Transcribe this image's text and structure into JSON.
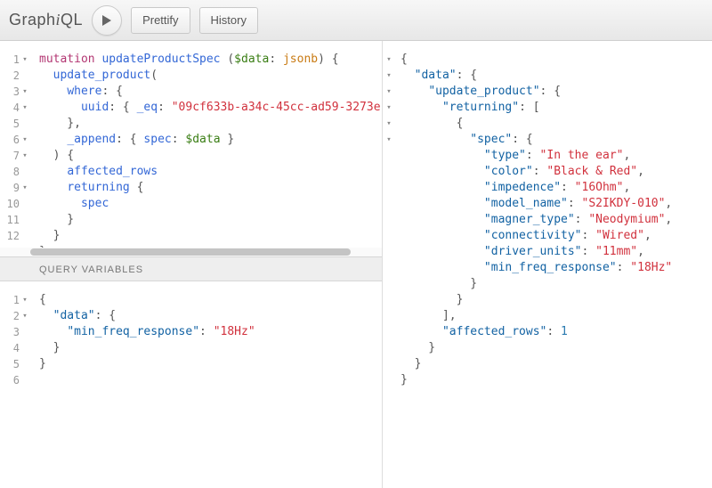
{
  "topbar": {
    "logo_pre": "Graph",
    "logo_i": "i",
    "logo_post": "QL",
    "prettify": "Prettify",
    "history": "History"
  },
  "variables_header": "QUERY VARIABLES",
  "query": {
    "lines": [
      [
        {
          "t": "mutation ",
          "c": "kw"
        },
        {
          "t": "updateProductSpec ",
          "c": "def"
        },
        {
          "t": "(",
          "c": "punc"
        },
        {
          "t": "$data",
          "c": "var"
        },
        {
          "t": ": ",
          "c": "punc"
        },
        {
          "t": "jsonb",
          "c": "type"
        },
        {
          "t": ") {",
          "c": "punc"
        }
      ],
      [
        {
          "t": "  ",
          "c": ""
        },
        {
          "t": "update_product",
          "c": "attr"
        },
        {
          "t": "(",
          "c": "punc"
        }
      ],
      [
        {
          "t": "    ",
          "c": ""
        },
        {
          "t": "where",
          "c": "attr"
        },
        {
          "t": ": {",
          "c": "punc"
        }
      ],
      [
        {
          "t": "      ",
          "c": ""
        },
        {
          "t": "uuid",
          "c": "attr"
        },
        {
          "t": ": { ",
          "c": "punc"
        },
        {
          "t": "_eq",
          "c": "attr"
        },
        {
          "t": ": ",
          "c": "punc"
        },
        {
          "t": "\"09cf633b-a34c-45cc-ad59-3273e",
          "c": "str"
        }
      ],
      [
        {
          "t": "    },",
          "c": "punc"
        }
      ],
      [
        {
          "t": "    ",
          "c": ""
        },
        {
          "t": "_append",
          "c": "attr"
        },
        {
          "t": ": { ",
          "c": "punc"
        },
        {
          "t": "spec",
          "c": "attr"
        },
        {
          "t": ": ",
          "c": "punc"
        },
        {
          "t": "$data",
          "c": "var"
        },
        {
          "t": " }",
          "c": "punc"
        }
      ],
      [
        {
          "t": "  ) {",
          "c": "punc"
        }
      ],
      [
        {
          "t": "    ",
          "c": ""
        },
        {
          "t": "affected_rows",
          "c": "attr"
        }
      ],
      [
        {
          "t": "    ",
          "c": ""
        },
        {
          "t": "returning",
          "c": "attr"
        },
        {
          "t": " {",
          "c": "punc"
        }
      ],
      [
        {
          "t": "      ",
          "c": ""
        },
        {
          "t": "spec",
          "c": "attr"
        }
      ],
      [
        {
          "t": "    }",
          "c": "punc"
        }
      ],
      [
        {
          "t": "  }",
          "c": "punc"
        }
      ],
      [
        {
          "t": "}",
          "c": "punc"
        }
      ]
    ],
    "folds": [
      1,
      0,
      1,
      1,
      0,
      1,
      1,
      0,
      1,
      0,
      0,
      0,
      0
    ]
  },
  "variables": {
    "lines": [
      [
        {
          "t": "{",
          "c": "punc"
        }
      ],
      [
        {
          "t": "  ",
          "c": ""
        },
        {
          "t": "\"data\"",
          "c": "prop"
        },
        {
          "t": ": {",
          "c": "punc"
        }
      ],
      [
        {
          "t": "    ",
          "c": ""
        },
        {
          "t": "\"min_freq_response\"",
          "c": "prop"
        },
        {
          "t": ": ",
          "c": "punc"
        },
        {
          "t": "\"18Hz\"",
          "c": "str"
        }
      ],
      [
        {
          "t": "  }",
          "c": "punc"
        }
      ],
      [
        {
          "t": "}",
          "c": "punc"
        }
      ],
      [
        {
          "t": "",
          "c": ""
        }
      ]
    ],
    "folds": [
      1,
      1,
      0,
      0,
      0,
      0
    ]
  },
  "result": {
    "lines": [
      [
        {
          "t": "{",
          "c": "punc"
        }
      ],
      [
        {
          "t": "  ",
          "c": ""
        },
        {
          "t": "\"data\"",
          "c": "prop"
        },
        {
          "t": ": {",
          "c": "punc"
        }
      ],
      [
        {
          "t": "    ",
          "c": ""
        },
        {
          "t": "\"update_product\"",
          "c": "prop"
        },
        {
          "t": ": {",
          "c": "punc"
        }
      ],
      [
        {
          "t": "      ",
          "c": ""
        },
        {
          "t": "\"returning\"",
          "c": "prop"
        },
        {
          "t": ": [",
          "c": "punc"
        }
      ],
      [
        {
          "t": "        {",
          "c": "punc"
        }
      ],
      [
        {
          "t": "          ",
          "c": ""
        },
        {
          "t": "\"spec\"",
          "c": "prop"
        },
        {
          "t": ": {",
          "c": "punc"
        }
      ],
      [
        {
          "t": "            ",
          "c": ""
        },
        {
          "t": "\"type\"",
          "c": "prop"
        },
        {
          "t": ": ",
          "c": "punc"
        },
        {
          "t": "\"In the ear\"",
          "c": "str"
        },
        {
          "t": ",",
          "c": "punc"
        }
      ],
      [
        {
          "t": "            ",
          "c": ""
        },
        {
          "t": "\"color\"",
          "c": "prop"
        },
        {
          "t": ": ",
          "c": "punc"
        },
        {
          "t": "\"Black & Red\"",
          "c": "str"
        },
        {
          "t": ",",
          "c": "punc"
        }
      ],
      [
        {
          "t": "            ",
          "c": ""
        },
        {
          "t": "\"impedence\"",
          "c": "prop"
        },
        {
          "t": ": ",
          "c": "punc"
        },
        {
          "t": "\"16Ohm\"",
          "c": "str"
        },
        {
          "t": ",",
          "c": "punc"
        }
      ],
      [
        {
          "t": "            ",
          "c": ""
        },
        {
          "t": "\"model_name\"",
          "c": "prop"
        },
        {
          "t": ": ",
          "c": "punc"
        },
        {
          "t": "\"S2IKDY-010\"",
          "c": "str"
        },
        {
          "t": ",",
          "c": "punc"
        }
      ],
      [
        {
          "t": "            ",
          "c": ""
        },
        {
          "t": "\"magner_type\"",
          "c": "prop"
        },
        {
          "t": ": ",
          "c": "punc"
        },
        {
          "t": "\"Neodymium\"",
          "c": "str"
        },
        {
          "t": ",",
          "c": "punc"
        }
      ],
      [
        {
          "t": "            ",
          "c": ""
        },
        {
          "t": "\"connectivity\"",
          "c": "prop"
        },
        {
          "t": ": ",
          "c": "punc"
        },
        {
          "t": "\"Wired\"",
          "c": "str"
        },
        {
          "t": ",",
          "c": "punc"
        }
      ],
      [
        {
          "t": "            ",
          "c": ""
        },
        {
          "t": "\"driver_units\"",
          "c": "prop"
        },
        {
          "t": ": ",
          "c": "punc"
        },
        {
          "t": "\"11mm\"",
          "c": "str"
        },
        {
          "t": ",",
          "c": "punc"
        }
      ],
      [
        {
          "t": "            ",
          "c": ""
        },
        {
          "t": "\"min_freq_response\"",
          "c": "prop"
        },
        {
          "t": ": ",
          "c": "punc"
        },
        {
          "t": "\"18Hz\"",
          "c": "str"
        }
      ],
      [
        {
          "t": "          }",
          "c": "punc"
        }
      ],
      [
        {
          "t": "        }",
          "c": "punc"
        }
      ],
      [
        {
          "t": "      ],",
          "c": "punc"
        }
      ],
      [
        {
          "t": "      ",
          "c": ""
        },
        {
          "t": "\"affected_rows\"",
          "c": "prop"
        },
        {
          "t": ": ",
          "c": "punc"
        },
        {
          "t": "1",
          "c": "num"
        }
      ],
      [
        {
          "t": "    }",
          "c": "punc"
        }
      ],
      [
        {
          "t": "  }",
          "c": "punc"
        }
      ],
      [
        {
          "t": "}",
          "c": "punc"
        }
      ]
    ],
    "folds": [
      1,
      1,
      1,
      1,
      1,
      1,
      0,
      0,
      0,
      0,
      0,
      0,
      0,
      0,
      0,
      0,
      0,
      0,
      0,
      0,
      0
    ]
  }
}
